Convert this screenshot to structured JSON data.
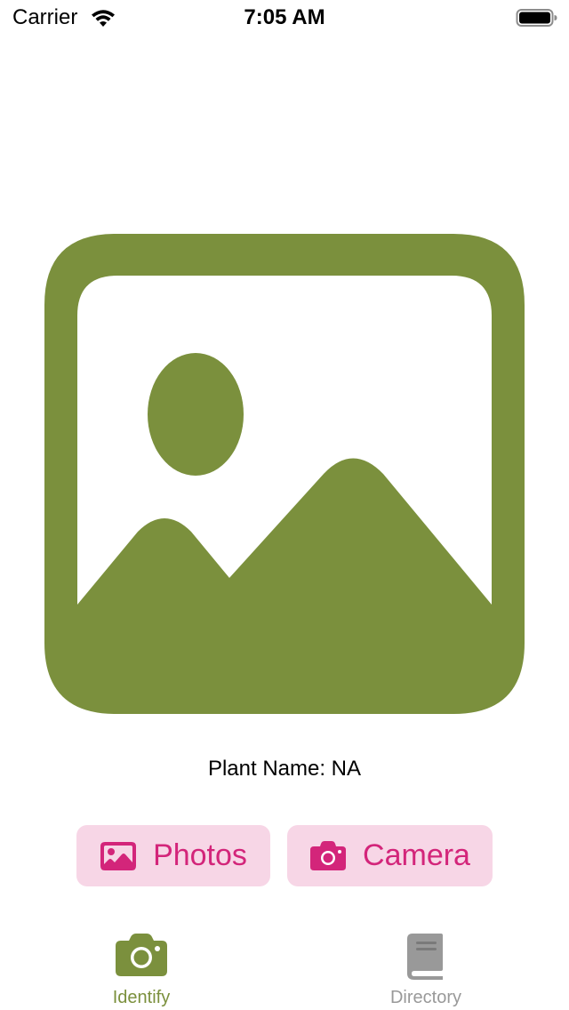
{
  "status_bar": {
    "carrier": "Carrier",
    "time": "7:05 AM",
    "icons": [
      "wifi-icon",
      "battery-icon"
    ]
  },
  "main": {
    "image_icon": "photo-placeholder-icon",
    "plant_name_label": "Plant Name: NA"
  },
  "actions": {
    "photos": {
      "label": "Photos",
      "icon": "photo-icon"
    },
    "camera": {
      "label": "Camera",
      "icon": "camera-icon"
    }
  },
  "tab_bar": {
    "tabs": [
      {
        "label": "Identify",
        "icon": "camera-icon",
        "selected": true
      },
      {
        "label": "Directory",
        "icon": "book-icon",
        "selected": false
      }
    ]
  },
  "colors": {
    "accent_green": "#7b903d",
    "button_pink_bg": "#f7d6e6",
    "button_pink_text": "#d3257a",
    "inactive_gray": "#999999"
  }
}
